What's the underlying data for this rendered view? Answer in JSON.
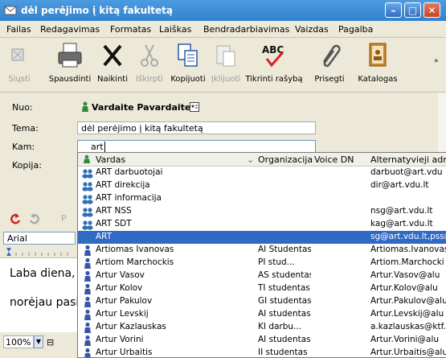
{
  "window": {
    "title": "dėl perėjimo į kitą fakultetą",
    "controls": [
      "minimize",
      "maximize",
      "close"
    ]
  },
  "menu": [
    "Failas",
    "Redagavimas",
    "Formatas",
    "Laiškas",
    "Bendradarbiavimas",
    "Vaizdas",
    "Pagalba"
  ],
  "toolbar": [
    {
      "label": "Siųsti",
      "icon": "send-icon",
      "enabled": false
    },
    {
      "label": "Spausdinti",
      "icon": "printer-icon",
      "enabled": true
    },
    {
      "label": "Naikinti",
      "icon": "delete-icon",
      "enabled": true
    },
    {
      "label": "Iškirpti",
      "icon": "cut-icon",
      "enabled": false
    },
    {
      "label": "Kopijuoti",
      "icon": "copy-icon",
      "enabled": true
    },
    {
      "label": "Įklijuoti",
      "icon": "paste-icon",
      "enabled": false
    },
    {
      "label": "Tikrinti rašybą",
      "icon": "spellcheck-icon",
      "enabled": true
    },
    {
      "label": "Prisegti",
      "icon": "paperclip-icon",
      "enabled": true
    },
    {
      "label": "Katalogas",
      "icon": "address-book-icon",
      "enabled": true
    }
  ],
  "headers": {
    "from_label": "Nuo:",
    "from_value": "Vardaite Pavardaite",
    "subject_label": "Tema:",
    "subject_value": "dėl perėjimo į kitą fakultetą",
    "to_label": "Kam:",
    "to_value": "art",
    "cc_label": "Kopija:"
  },
  "format": {
    "font": "Arial",
    "zoom": "100%"
  },
  "body_lines": [
    "Laba diena,",
    "norėjau pasit"
  ],
  "autocomplete": {
    "columns": [
      "Vardas",
      "Organizacija",
      "Voice DN",
      "Alternatyvieji adresai"
    ],
    "rows": [
      {
        "name": "ART darbuotojai",
        "org": "",
        "alt": "darbuot@art.vdu",
        "type": "group"
      },
      {
        "name": "ART direkcija",
        "org": "",
        "alt": "dir@art.vdu.lt",
        "type": "group"
      },
      {
        "name": "ART informacija",
        "org": "",
        "alt": "",
        "type": "group"
      },
      {
        "name": "ART NSS",
        "org": "",
        "alt": "nsg@art.vdu.lt",
        "type": "group"
      },
      {
        "name": "ART SDT",
        "org": "",
        "alt": "kag@art.vdu.lt",
        "type": "group"
      },
      {
        "name": "ART",
        "org": "",
        "alt": "sg@art.vdu.lt,pss@",
        "type": "group",
        "selected": true
      },
      {
        "name": "Artiomas Ivanovas",
        "org": "AI Studentas",
        "alt": "Artiomas.Ivanovas@",
        "type": "person"
      },
      {
        "name": "Artiom Marchockis",
        "org": "PI stud...",
        "alt": "Artiom.Marchocki",
        "type": "person"
      },
      {
        "name": "Artur Vasov",
        "org": "AS studentas",
        "alt": "Artur.Vasov@alu",
        "type": "person"
      },
      {
        "name": "Artur Kolov",
        "org": "TI studentas",
        "alt": "Artur.Kolov@alu",
        "type": "person"
      },
      {
        "name": "Artur Pakulov",
        "org": "GI studentas",
        "alt": "Artur.Pakulov@alu",
        "type": "person"
      },
      {
        "name": "Artur Levskij",
        "org": "AI studentas",
        "alt": "Artur.Levskij@alu",
        "type": "person"
      },
      {
        "name": "Artur Kazlauskas",
        "org": "KI darbu...",
        "alt": "a.kazlauskas@ktf.v",
        "type": "person"
      },
      {
        "name": "Artur Vorini",
        "org": "AI studentas",
        "alt": "Artur.Vorini@alu",
        "type": "person"
      },
      {
        "name": "Artur Urbaitis",
        "org": "II studentas",
        "alt": "Artur.Urbaitis@alu",
        "type": "person"
      }
    ]
  }
}
